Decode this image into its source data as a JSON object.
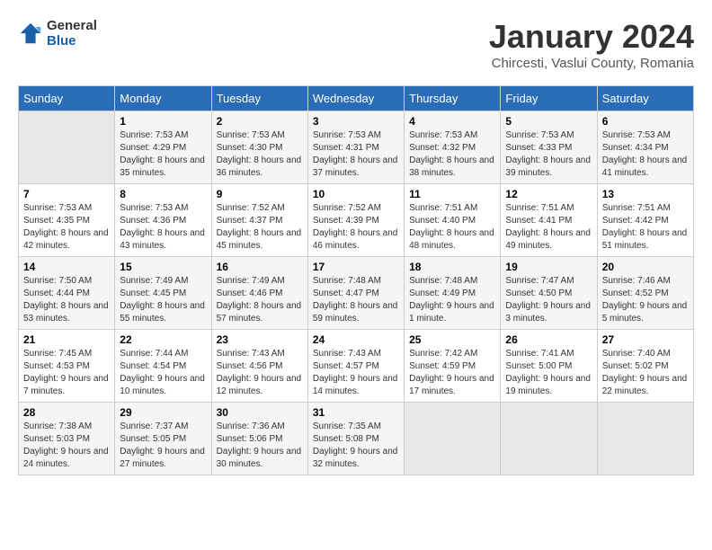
{
  "header": {
    "logo_general": "General",
    "logo_blue": "Blue",
    "month": "January 2024",
    "location": "Chircesti, Vaslui County, Romania"
  },
  "weekdays": [
    "Sunday",
    "Monday",
    "Tuesday",
    "Wednesday",
    "Thursday",
    "Friday",
    "Saturday"
  ],
  "weeks": [
    [
      {
        "day": "",
        "sunrise": "",
        "sunset": "",
        "daylight": ""
      },
      {
        "day": "1",
        "sunrise": "7:53 AM",
        "sunset": "4:29 PM",
        "daylight": "8 hours and 35 minutes."
      },
      {
        "day": "2",
        "sunrise": "7:53 AM",
        "sunset": "4:30 PM",
        "daylight": "8 hours and 36 minutes."
      },
      {
        "day": "3",
        "sunrise": "7:53 AM",
        "sunset": "4:31 PM",
        "daylight": "8 hours and 37 minutes."
      },
      {
        "day": "4",
        "sunrise": "7:53 AM",
        "sunset": "4:32 PM",
        "daylight": "8 hours and 38 minutes."
      },
      {
        "day": "5",
        "sunrise": "7:53 AM",
        "sunset": "4:33 PM",
        "daylight": "8 hours and 39 minutes."
      },
      {
        "day": "6",
        "sunrise": "7:53 AM",
        "sunset": "4:34 PM",
        "daylight": "8 hours and 41 minutes."
      }
    ],
    [
      {
        "day": "7",
        "sunrise": "7:53 AM",
        "sunset": "4:35 PM",
        "daylight": "8 hours and 42 minutes."
      },
      {
        "day": "8",
        "sunrise": "7:53 AM",
        "sunset": "4:36 PM",
        "daylight": "8 hours and 43 minutes."
      },
      {
        "day": "9",
        "sunrise": "7:52 AM",
        "sunset": "4:37 PM",
        "daylight": "8 hours and 45 minutes."
      },
      {
        "day": "10",
        "sunrise": "7:52 AM",
        "sunset": "4:39 PM",
        "daylight": "8 hours and 46 minutes."
      },
      {
        "day": "11",
        "sunrise": "7:51 AM",
        "sunset": "4:40 PM",
        "daylight": "8 hours and 48 minutes."
      },
      {
        "day": "12",
        "sunrise": "7:51 AM",
        "sunset": "4:41 PM",
        "daylight": "8 hours and 49 minutes."
      },
      {
        "day": "13",
        "sunrise": "7:51 AM",
        "sunset": "4:42 PM",
        "daylight": "8 hours and 51 minutes."
      }
    ],
    [
      {
        "day": "14",
        "sunrise": "7:50 AM",
        "sunset": "4:44 PM",
        "daylight": "8 hours and 53 minutes."
      },
      {
        "day": "15",
        "sunrise": "7:49 AM",
        "sunset": "4:45 PM",
        "daylight": "8 hours and 55 minutes."
      },
      {
        "day": "16",
        "sunrise": "7:49 AM",
        "sunset": "4:46 PM",
        "daylight": "8 hours and 57 minutes."
      },
      {
        "day": "17",
        "sunrise": "7:48 AM",
        "sunset": "4:47 PM",
        "daylight": "8 hours and 59 minutes."
      },
      {
        "day": "18",
        "sunrise": "7:48 AM",
        "sunset": "4:49 PM",
        "daylight": "9 hours and 1 minute."
      },
      {
        "day": "19",
        "sunrise": "7:47 AM",
        "sunset": "4:50 PM",
        "daylight": "9 hours and 3 minutes."
      },
      {
        "day": "20",
        "sunrise": "7:46 AM",
        "sunset": "4:52 PM",
        "daylight": "9 hours and 5 minutes."
      }
    ],
    [
      {
        "day": "21",
        "sunrise": "7:45 AM",
        "sunset": "4:53 PM",
        "daylight": "9 hours and 7 minutes."
      },
      {
        "day": "22",
        "sunrise": "7:44 AM",
        "sunset": "4:54 PM",
        "daylight": "9 hours and 10 minutes."
      },
      {
        "day": "23",
        "sunrise": "7:43 AM",
        "sunset": "4:56 PM",
        "daylight": "9 hours and 12 minutes."
      },
      {
        "day": "24",
        "sunrise": "7:43 AM",
        "sunset": "4:57 PM",
        "daylight": "9 hours and 14 minutes."
      },
      {
        "day": "25",
        "sunrise": "7:42 AM",
        "sunset": "4:59 PM",
        "daylight": "9 hours and 17 minutes."
      },
      {
        "day": "26",
        "sunrise": "7:41 AM",
        "sunset": "5:00 PM",
        "daylight": "9 hours and 19 minutes."
      },
      {
        "day": "27",
        "sunrise": "7:40 AM",
        "sunset": "5:02 PM",
        "daylight": "9 hours and 22 minutes."
      }
    ],
    [
      {
        "day": "28",
        "sunrise": "7:38 AM",
        "sunset": "5:03 PM",
        "daylight": "9 hours and 24 minutes."
      },
      {
        "day": "29",
        "sunrise": "7:37 AM",
        "sunset": "5:05 PM",
        "daylight": "9 hours and 27 minutes."
      },
      {
        "day": "30",
        "sunrise": "7:36 AM",
        "sunset": "5:06 PM",
        "daylight": "9 hours and 30 minutes."
      },
      {
        "day": "31",
        "sunrise": "7:35 AM",
        "sunset": "5:08 PM",
        "daylight": "9 hours and 32 minutes."
      },
      {
        "day": "",
        "sunrise": "",
        "sunset": "",
        "daylight": ""
      },
      {
        "day": "",
        "sunrise": "",
        "sunset": "",
        "daylight": ""
      },
      {
        "day": "",
        "sunrise": "",
        "sunset": "",
        "daylight": ""
      }
    ]
  ]
}
